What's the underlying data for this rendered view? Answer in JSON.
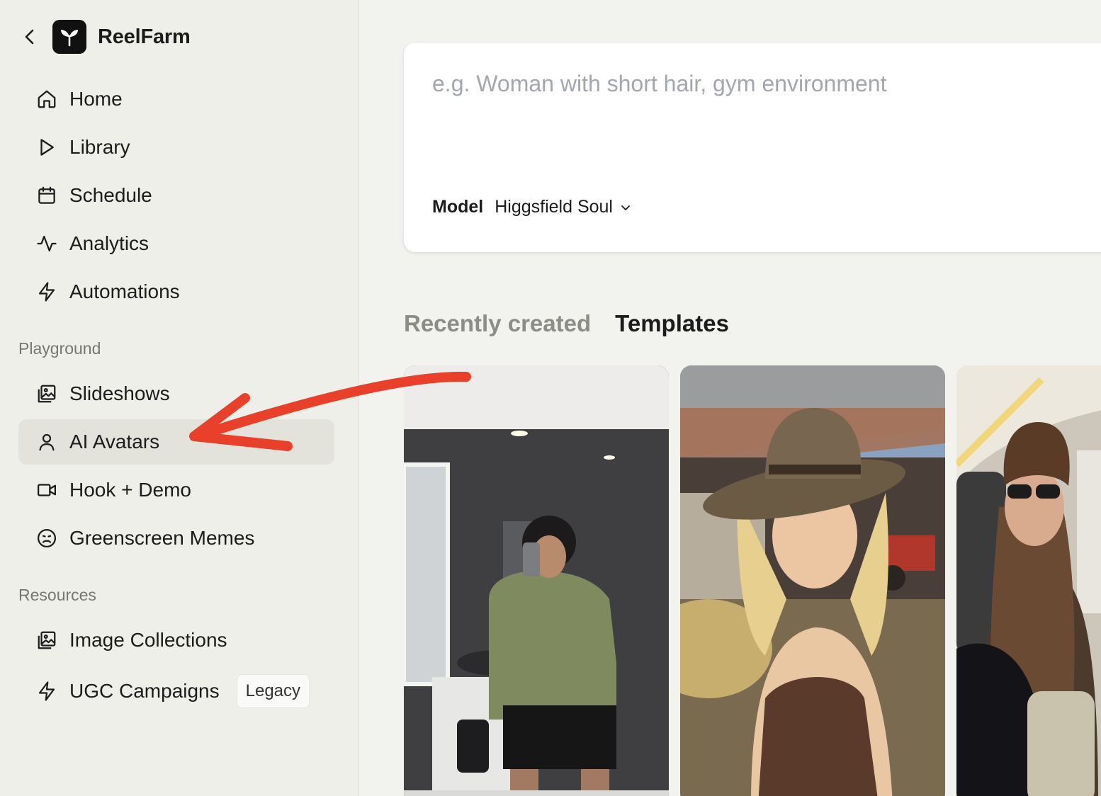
{
  "app": {
    "name": "ReelFarm"
  },
  "nav": {
    "main": [
      {
        "label": "Home",
        "icon": "home-icon"
      },
      {
        "label": "Library",
        "icon": "play-icon"
      },
      {
        "label": "Schedule",
        "icon": "calendar-icon"
      },
      {
        "label": "Analytics",
        "icon": "activity-icon"
      },
      {
        "label": "Automations",
        "icon": "lightning-icon"
      }
    ],
    "playground_label": "Playground",
    "playground": [
      {
        "label": "Slideshows",
        "icon": "image-stack-icon"
      },
      {
        "label": "AI Avatars",
        "icon": "user-icon",
        "active": true
      },
      {
        "label": "Hook + Demo",
        "icon": "video-camera-icon"
      },
      {
        "label": "Greenscreen Memes",
        "icon": "frown-face-icon"
      }
    ],
    "resources_label": "Resources",
    "resources": [
      {
        "label": "Image Collections",
        "icon": "image-stack-icon"
      },
      {
        "label": "UGC Campaigns",
        "icon": "lightning-icon",
        "badge": "Legacy"
      }
    ]
  },
  "prompt": {
    "placeholder": "e.g. Woman with short hair, gym environment",
    "value": "",
    "model_label": "Model",
    "model_value": "Higgsfield Soul"
  },
  "tabs": [
    {
      "label": "Recently created",
      "active": false
    },
    {
      "label": "Templates",
      "active": true
    }
  ],
  "colors": {
    "sidebar_bg": "#efefea",
    "active_item_bg": "#e3e3dc",
    "annotation_arrow": "#e8402a"
  }
}
